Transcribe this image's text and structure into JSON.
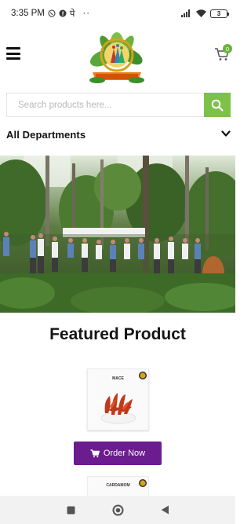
{
  "status_bar": {
    "time": "3:35 PM",
    "notifications": [
      "whatsapp-icon",
      "facebook-icon",
      "पे"
    ],
    "more": "··",
    "battery": "3"
  },
  "header": {
    "logo_text": "TOTAKASHI",
    "logo_subtext": "COOPERATIVE SOCIETY",
    "cart_count": "0"
  },
  "search": {
    "placeholder": "Search products here..."
  },
  "departments": {
    "label": "All Departments"
  },
  "featured": {
    "title": "Featured Product",
    "products": [
      {
        "name": "MACE"
      },
      {
        "name": "CARDAMOM"
      }
    ],
    "order_label": "Order Now"
  },
  "colors": {
    "accent_green": "#7dc14a",
    "order_purple": "#6b1c8e"
  }
}
